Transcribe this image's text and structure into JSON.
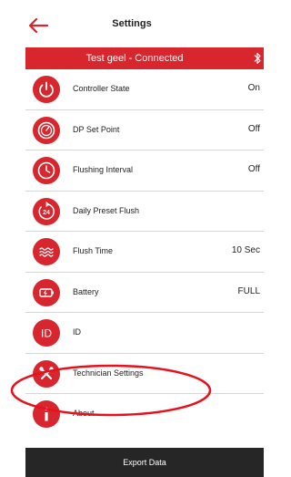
{
  "header": {
    "title": "Settings"
  },
  "connection": {
    "status": "Test geel - Connected"
  },
  "colors": {
    "accent": "#d8262e",
    "footer": "#262626",
    "annotation": "#e8101c"
  },
  "items": [
    {
      "label": "Controller State",
      "value": "On",
      "icon": "power-icon"
    },
    {
      "label": "DP Set Point",
      "value": "Off",
      "icon": "gauge-icon"
    },
    {
      "label": "Flushing Interval",
      "value": "Off",
      "icon": "clock-icon"
    },
    {
      "label": "Daily Preset Flush",
      "value": "",
      "icon": "24h-icon"
    },
    {
      "label": "Flush Time",
      "value": "10 Sec",
      "icon": "waves-icon"
    },
    {
      "label": "Battery",
      "value": "FULL",
      "icon": "battery-icon"
    },
    {
      "label": "ID",
      "value": "",
      "icon": "id-icon"
    },
    {
      "label": "Technician Settings",
      "value": "",
      "icon": "tools-icon"
    },
    {
      "label": "About",
      "value": "",
      "icon": "info-icon"
    }
  ],
  "footer": {
    "label": "Export Data"
  },
  "icon_text": {
    "daily_preset": "24",
    "id": "ID"
  }
}
